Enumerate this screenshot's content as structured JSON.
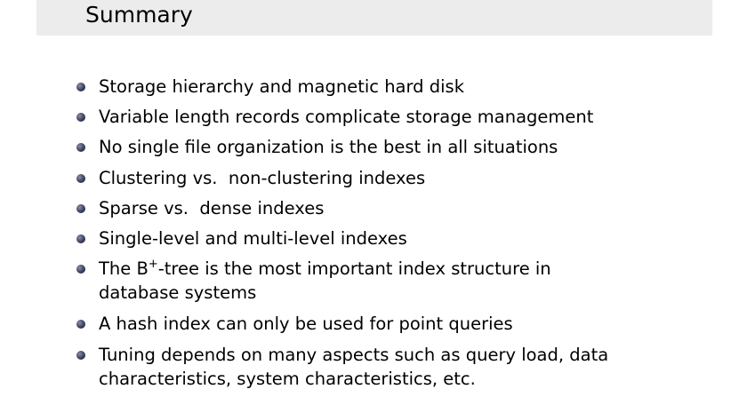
{
  "slide": {
    "title": "Summary",
    "bullets": [
      "Storage hierarchy and magnetic hard disk",
      "Variable length records complicate storage management",
      "No single file organization is the best in all situations",
      "Clustering vs.  non-clustering indexes",
      "Sparse vs.  dense indexes",
      "Single-level and multi-level indexes",
      {
        "before": "The B",
        "sup": "+",
        "after": "-tree is the most important index structure in database systems"
      },
      "A hash index can only be used for point queries",
      "Tuning depends on many aspects such as query load, data characteristics, system characteristics, etc."
    ]
  },
  "colors": {
    "title_bar": "#ececec",
    "bullet": "#2e3350"
  }
}
